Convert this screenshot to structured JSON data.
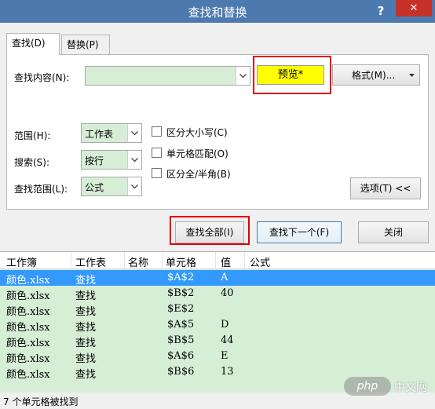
{
  "window": {
    "title": "查找和替换",
    "help_label": "?",
    "close_label": "✕"
  },
  "tabs": [
    {
      "label": "查找(D)",
      "active": true
    },
    {
      "label": "替换(P)",
      "active": false
    }
  ],
  "find": {
    "find_what_label": "查找内容(N):",
    "find_what_value": "",
    "preview_label": "预览*",
    "format_label": "格式(M)...",
    "within_label": "范围(H):",
    "within_value": "工作表",
    "search_label": "搜索(S):",
    "search_value": "按行",
    "look_in_label": "查找范围(L):",
    "look_in_value": "公式",
    "options": [
      {
        "label": "区分大小写(C)",
        "checked": false
      },
      {
        "label": "单元格匹配(O)",
        "checked": false
      },
      {
        "label": "区分全/半角(B)",
        "checked": false
      }
    ],
    "options_button_label": "选项(T) <<"
  },
  "actions": {
    "find_all_label": "查找全部(I)",
    "find_next_label": "查找下一个(F)",
    "close_label": "关闭"
  },
  "results": {
    "columns": [
      "工作簿",
      "工作表",
      "名称",
      "单元格",
      "值",
      "公式"
    ],
    "rows": [
      {
        "book": "颜色.xlsx",
        "sheet": "查找",
        "name": "",
        "cell": "$A$2",
        "value": "A",
        "formula": "",
        "selected": true
      },
      {
        "book": "颜色.xlsx",
        "sheet": "查找",
        "name": "",
        "cell": "$B$2",
        "value": "40",
        "formula": "",
        "selected": false
      },
      {
        "book": "颜色.xlsx",
        "sheet": "查找",
        "name": "",
        "cell": "$E$2",
        "value": "",
        "formula": "",
        "selected": false
      },
      {
        "book": "颜色.xlsx",
        "sheet": "查找",
        "name": "",
        "cell": "$A$5",
        "value": "D",
        "formula": "",
        "selected": false
      },
      {
        "book": "颜色.xlsx",
        "sheet": "查找",
        "name": "",
        "cell": "$B$5",
        "value": "44",
        "formula": "",
        "selected": false
      },
      {
        "book": "颜色.xlsx",
        "sheet": "查找",
        "name": "",
        "cell": "$A$6",
        "value": "E",
        "formula": "",
        "selected": false
      },
      {
        "book": "颜色.xlsx",
        "sheet": "查找",
        "name": "",
        "cell": "$B$6",
        "value": "13",
        "formula": "",
        "selected": false
      }
    ]
  },
  "status": {
    "text": "7 个单元格被找到"
  },
  "watermark": {
    "logo_text": "php",
    "site_text": "中文网"
  },
  "colors": {
    "title_bar": "#4c7aaf",
    "close_button": "#c7312a",
    "preview_fill": "#ffff00",
    "highlight_box": "#e00000",
    "results_fill": "#d6eed6",
    "selected_row": "#3399ff"
  },
  "icons": {
    "dropdown": "chevron-down-icon",
    "checkbox": "checkbox-icon",
    "close": "close-icon",
    "help": "help-icon"
  }
}
